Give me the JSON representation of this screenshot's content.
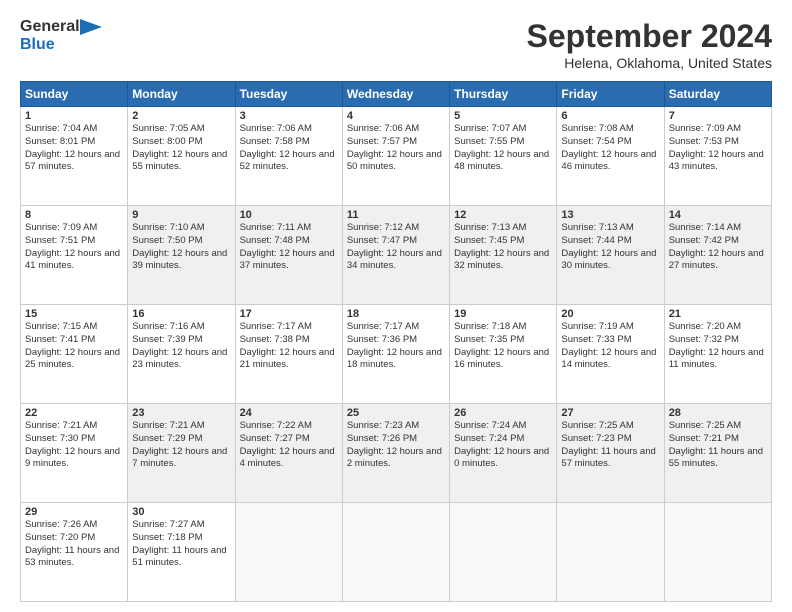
{
  "header": {
    "logo_line1": "General",
    "logo_line2": "Blue",
    "title": "September 2024",
    "subtitle": "Helena, Oklahoma, United States"
  },
  "days_of_week": [
    "Sunday",
    "Monday",
    "Tuesday",
    "Wednesday",
    "Thursday",
    "Friday",
    "Saturday"
  ],
  "weeks": [
    [
      {
        "day": "1",
        "sunrise": "Sunrise: 7:04 AM",
        "sunset": "Sunset: 8:01 PM",
        "daylight": "Daylight: 12 hours and 57 minutes."
      },
      {
        "day": "2",
        "sunrise": "Sunrise: 7:05 AM",
        "sunset": "Sunset: 8:00 PM",
        "daylight": "Daylight: 12 hours and 55 minutes."
      },
      {
        "day": "3",
        "sunrise": "Sunrise: 7:06 AM",
        "sunset": "Sunset: 7:58 PM",
        "daylight": "Daylight: 12 hours and 52 minutes."
      },
      {
        "day": "4",
        "sunrise": "Sunrise: 7:06 AM",
        "sunset": "Sunset: 7:57 PM",
        "daylight": "Daylight: 12 hours and 50 minutes."
      },
      {
        "day": "5",
        "sunrise": "Sunrise: 7:07 AM",
        "sunset": "Sunset: 7:55 PM",
        "daylight": "Daylight: 12 hours and 48 minutes."
      },
      {
        "day": "6",
        "sunrise": "Sunrise: 7:08 AM",
        "sunset": "Sunset: 7:54 PM",
        "daylight": "Daylight: 12 hours and 46 minutes."
      },
      {
        "day": "7",
        "sunrise": "Sunrise: 7:09 AM",
        "sunset": "Sunset: 7:53 PM",
        "daylight": "Daylight: 12 hours and 43 minutes."
      }
    ],
    [
      {
        "day": "8",
        "sunrise": "Sunrise: 7:09 AM",
        "sunset": "Sunset: 7:51 PM",
        "daylight": "Daylight: 12 hours and 41 minutes."
      },
      {
        "day": "9",
        "sunrise": "Sunrise: 7:10 AM",
        "sunset": "Sunset: 7:50 PM",
        "daylight": "Daylight: 12 hours and 39 minutes."
      },
      {
        "day": "10",
        "sunrise": "Sunrise: 7:11 AM",
        "sunset": "Sunset: 7:48 PM",
        "daylight": "Daylight: 12 hours and 37 minutes."
      },
      {
        "day": "11",
        "sunrise": "Sunrise: 7:12 AM",
        "sunset": "Sunset: 7:47 PM",
        "daylight": "Daylight: 12 hours and 34 minutes."
      },
      {
        "day": "12",
        "sunrise": "Sunrise: 7:13 AM",
        "sunset": "Sunset: 7:45 PM",
        "daylight": "Daylight: 12 hours and 32 minutes."
      },
      {
        "day": "13",
        "sunrise": "Sunrise: 7:13 AM",
        "sunset": "Sunset: 7:44 PM",
        "daylight": "Daylight: 12 hours and 30 minutes."
      },
      {
        "day": "14",
        "sunrise": "Sunrise: 7:14 AM",
        "sunset": "Sunset: 7:42 PM",
        "daylight": "Daylight: 12 hours and 27 minutes."
      }
    ],
    [
      {
        "day": "15",
        "sunrise": "Sunrise: 7:15 AM",
        "sunset": "Sunset: 7:41 PM",
        "daylight": "Daylight: 12 hours and 25 minutes."
      },
      {
        "day": "16",
        "sunrise": "Sunrise: 7:16 AM",
        "sunset": "Sunset: 7:39 PM",
        "daylight": "Daylight: 12 hours and 23 minutes."
      },
      {
        "day": "17",
        "sunrise": "Sunrise: 7:17 AM",
        "sunset": "Sunset: 7:38 PM",
        "daylight": "Daylight: 12 hours and 21 minutes."
      },
      {
        "day": "18",
        "sunrise": "Sunrise: 7:17 AM",
        "sunset": "Sunset: 7:36 PM",
        "daylight": "Daylight: 12 hours and 18 minutes."
      },
      {
        "day": "19",
        "sunrise": "Sunrise: 7:18 AM",
        "sunset": "Sunset: 7:35 PM",
        "daylight": "Daylight: 12 hours and 16 minutes."
      },
      {
        "day": "20",
        "sunrise": "Sunrise: 7:19 AM",
        "sunset": "Sunset: 7:33 PM",
        "daylight": "Daylight: 12 hours and 14 minutes."
      },
      {
        "day": "21",
        "sunrise": "Sunrise: 7:20 AM",
        "sunset": "Sunset: 7:32 PM",
        "daylight": "Daylight: 12 hours and 11 minutes."
      }
    ],
    [
      {
        "day": "22",
        "sunrise": "Sunrise: 7:21 AM",
        "sunset": "Sunset: 7:30 PM",
        "daylight": "Daylight: 12 hours and 9 minutes."
      },
      {
        "day": "23",
        "sunrise": "Sunrise: 7:21 AM",
        "sunset": "Sunset: 7:29 PM",
        "daylight": "Daylight: 12 hours and 7 minutes."
      },
      {
        "day": "24",
        "sunrise": "Sunrise: 7:22 AM",
        "sunset": "Sunset: 7:27 PM",
        "daylight": "Daylight: 12 hours and 4 minutes."
      },
      {
        "day": "25",
        "sunrise": "Sunrise: 7:23 AM",
        "sunset": "Sunset: 7:26 PM",
        "daylight": "Daylight: 12 hours and 2 minutes."
      },
      {
        "day": "26",
        "sunrise": "Sunrise: 7:24 AM",
        "sunset": "Sunset: 7:24 PM",
        "daylight": "Daylight: 12 hours and 0 minutes."
      },
      {
        "day": "27",
        "sunrise": "Sunrise: 7:25 AM",
        "sunset": "Sunset: 7:23 PM",
        "daylight": "Daylight: 11 hours and 57 minutes."
      },
      {
        "day": "28",
        "sunrise": "Sunrise: 7:25 AM",
        "sunset": "Sunset: 7:21 PM",
        "daylight": "Daylight: 11 hours and 55 minutes."
      }
    ],
    [
      {
        "day": "29",
        "sunrise": "Sunrise: 7:26 AM",
        "sunset": "Sunset: 7:20 PM",
        "daylight": "Daylight: 11 hours and 53 minutes."
      },
      {
        "day": "30",
        "sunrise": "Sunrise: 7:27 AM",
        "sunset": "Sunset: 7:18 PM",
        "daylight": "Daylight: 11 hours and 51 minutes."
      },
      null,
      null,
      null,
      null,
      null
    ]
  ]
}
